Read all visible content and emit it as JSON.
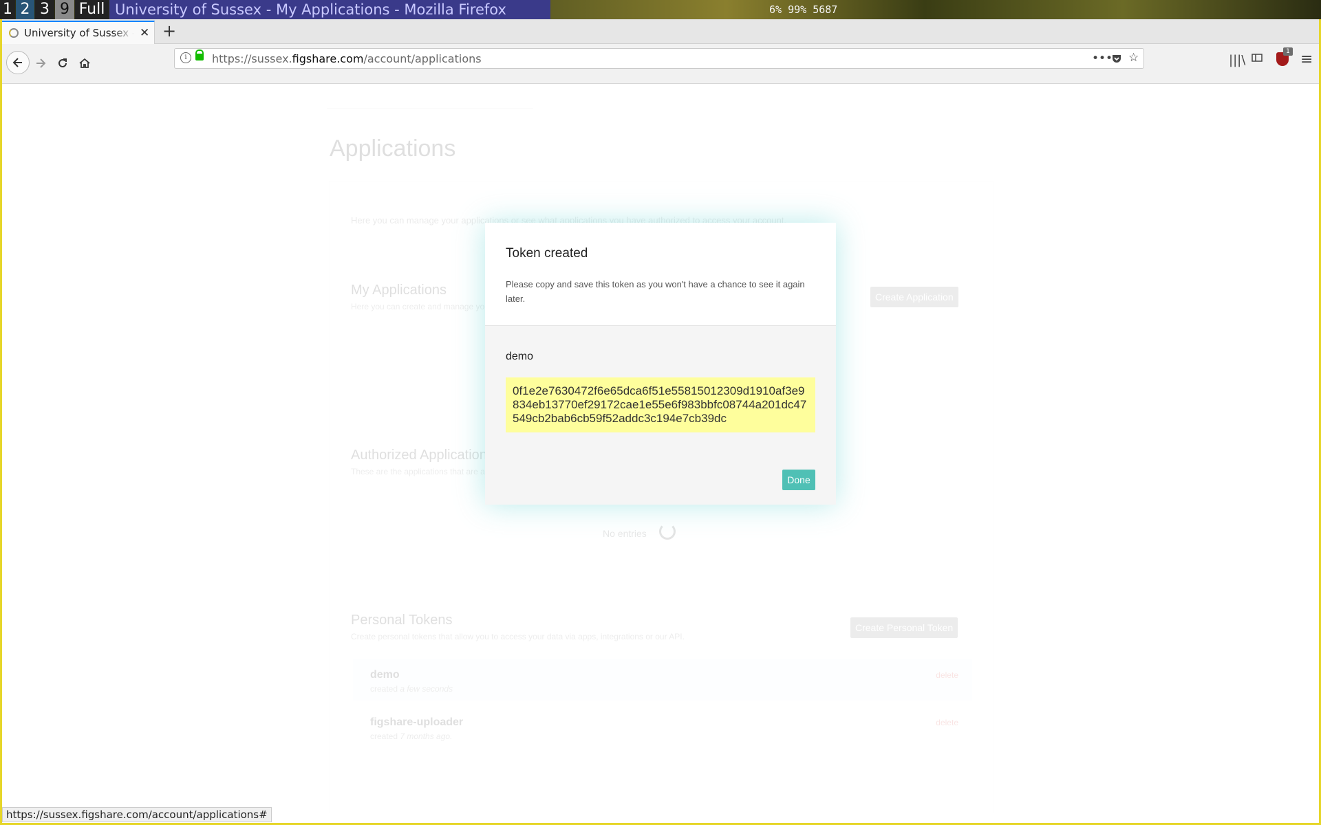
{
  "wm": {
    "workspaces": [
      "1",
      "2",
      "3",
      "9",
      "Full"
    ],
    "window_title": "University of Sussex - My Applications - Mozilla Firefox",
    "status": "6%  99%  5687"
  },
  "browser": {
    "tab_title": "University of Sussex - My Applications",
    "url_prefix": "https://sussex.",
    "url_domain": "figshare.com",
    "url_path": "/account/applications",
    "status_url": "https://sussex.figshare.com/account/applications#"
  },
  "page": {
    "title": "Applications",
    "intro": "Here you can manage your applications or see what applications you have authorized to access your account.",
    "my_apps": {
      "heading": "My Applications",
      "sub": "Here you can create and manage your applications.",
      "button": "Create Application"
    },
    "authorized": {
      "heading": "Authorized Applications",
      "sub": "These are the applications that are authorized to access your account.",
      "empty": "No entries"
    },
    "tokens": {
      "heading": "Personal Tokens",
      "sub": "Create personal tokens that allow you to access your data via apps, integrations or our API.",
      "button": "Create Personal Token",
      "items": [
        {
          "name": "demo",
          "created_prefix": "created ",
          "created_ago": "a few seconds",
          "delete": "delete"
        },
        {
          "name": "figshare-uploader",
          "created_prefix": "created ",
          "created_ago": "7 months ago.",
          "delete": "delete"
        }
      ]
    }
  },
  "modal": {
    "title": "Token created",
    "text": "Please copy and save this token as you won't have a chance to see it again later.",
    "token_name": "demo",
    "token_value": "0f1e2e7630472f6e65dca6f51e55815012309d1910af3e9834eb13770ef29172cae1e55e6f983bbfc08744a201dc47549cb2bab6cb59f52addc3c194e7cb39dc",
    "done": "Done"
  }
}
